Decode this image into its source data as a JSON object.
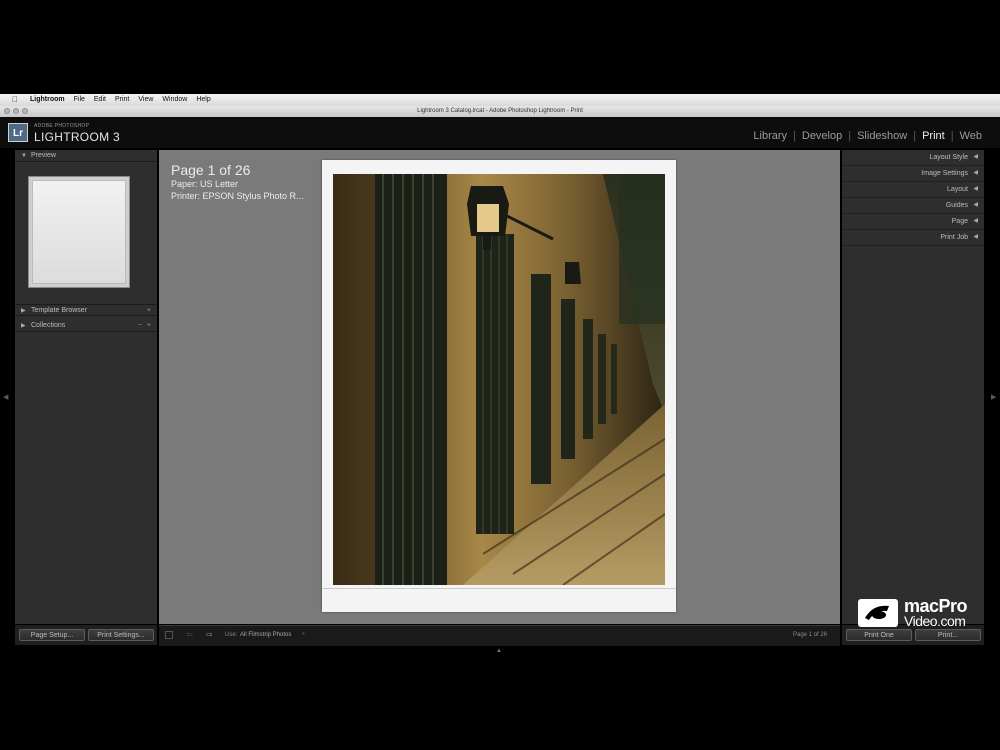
{
  "menubar": {
    "items": [
      "Lightroom",
      "File",
      "Edit",
      "Print",
      "View",
      "Window",
      "Help"
    ]
  },
  "window": {
    "title": "Lightroom 3 Catalog.lrcat - Adobe Photoshop Lightroom - Print"
  },
  "identity": {
    "badge": "Lr",
    "brand_small": "ADOBE PHOTOSHOP",
    "brand_big": "LIGHTROOM 3"
  },
  "modules": {
    "items": [
      "Library",
      "Develop",
      "Slideshow",
      "Print",
      "Web"
    ],
    "active": "Print"
  },
  "left_panel": {
    "preview_label": "Preview",
    "template_browser_label": "Template Browser",
    "template_browser_plus": "+",
    "collections_label": "Collections",
    "collections_minus": "−",
    "collections_plus": "+"
  },
  "right_panel": {
    "sections": [
      "Layout Style",
      "Image Settings",
      "Layout",
      "Guides",
      "Page",
      "Print Job"
    ]
  },
  "page_info": {
    "page_count": "Page 1 of 26",
    "paper": "Paper:  US Letter",
    "printer": "Printer:  EPSON Stylus Photo R..."
  },
  "toolbar": {
    "use_label": "Use:",
    "use_value": "All Filmstrip Photos",
    "page_indicator": "Page 1 of 26"
  },
  "buttons": {
    "page_setup": "Page Setup...",
    "print_settings": "Print Settings...",
    "print_one": "Print One",
    "print": "Print..."
  },
  "watermark": {
    "line1": "macPro",
    "line2": "Video.com"
  },
  "colors": {
    "panel_bg": "#2e2e2e",
    "canvas_bg": "#7a7a7a",
    "active_module": "#f0f0f0",
    "inactive_module": "#9b9b9b"
  }
}
